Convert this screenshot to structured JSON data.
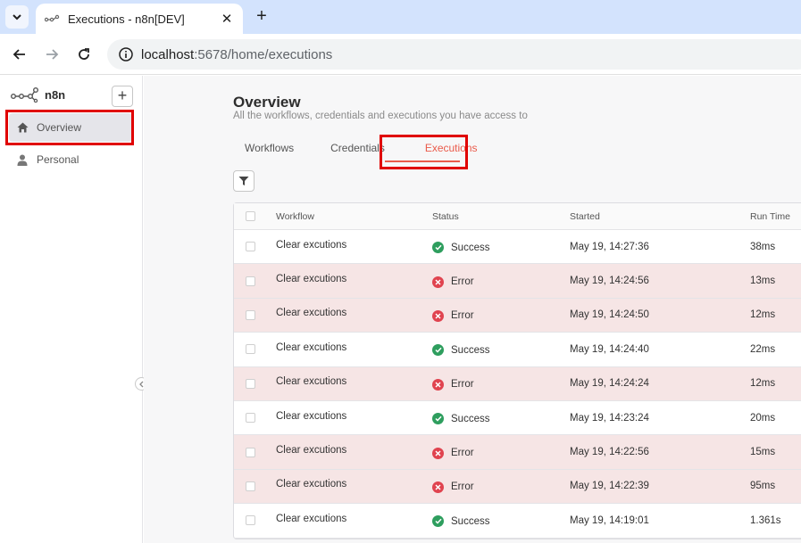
{
  "browser": {
    "tab_title": "Executions - n8n[DEV]",
    "url_host": "localhost",
    "url_path": ":5678/home/executions"
  },
  "sidebar": {
    "brand": "n8n",
    "items": [
      {
        "label": "Overview",
        "icon": "home-icon",
        "active": true
      },
      {
        "label": "Personal",
        "icon": "user-icon",
        "active": false
      }
    ]
  },
  "main": {
    "title": "Overview",
    "subtitle": "All the workflows, credentials and executions you have access to",
    "tabs": [
      {
        "label": "Workflows"
      },
      {
        "label": "Credentials"
      },
      {
        "label": "Executions",
        "active": true
      }
    ]
  },
  "table": {
    "headers": {
      "workflow": "Workflow",
      "status": "Status",
      "started": "Started",
      "run_time": "Run Time"
    },
    "rows": [
      {
        "workflow": "Clear excutions",
        "status": "Success",
        "started": "May 19, 14:27:36",
        "run_time": "38ms"
      },
      {
        "workflow": "Clear excutions",
        "status": "Error",
        "started": "May 19, 14:24:56",
        "run_time": "13ms"
      },
      {
        "workflow": "Clear excutions",
        "status": "Error",
        "started": "May 19, 14:24:50",
        "run_time": "12ms"
      },
      {
        "workflow": "Clear excutions",
        "status": "Success",
        "started": "May 19, 14:24:40",
        "run_time": "22ms"
      },
      {
        "workflow": "Clear excutions",
        "status": "Error",
        "started": "May 19, 14:24:24",
        "run_time": "12ms"
      },
      {
        "workflow": "Clear excutions",
        "status": "Success",
        "started": "May 19, 14:23:24",
        "run_time": "20ms"
      },
      {
        "workflow": "Clear excutions",
        "status": "Error",
        "started": "May 19, 14:22:56",
        "run_time": "15ms"
      },
      {
        "workflow": "Clear excutions",
        "status": "Error",
        "started": "May 19, 14:22:39",
        "run_time": "95ms"
      },
      {
        "workflow": "Clear excutions",
        "status": "Success",
        "started": "May 19, 14:19:01",
        "run_time": "1.361s"
      }
    ]
  },
  "colors": {
    "accent": "#ea5b4b",
    "success": "#2e9e5e",
    "error": "#e0434f",
    "error_row_bg": "#f6e5e5",
    "highlight_box": "#e00000"
  }
}
